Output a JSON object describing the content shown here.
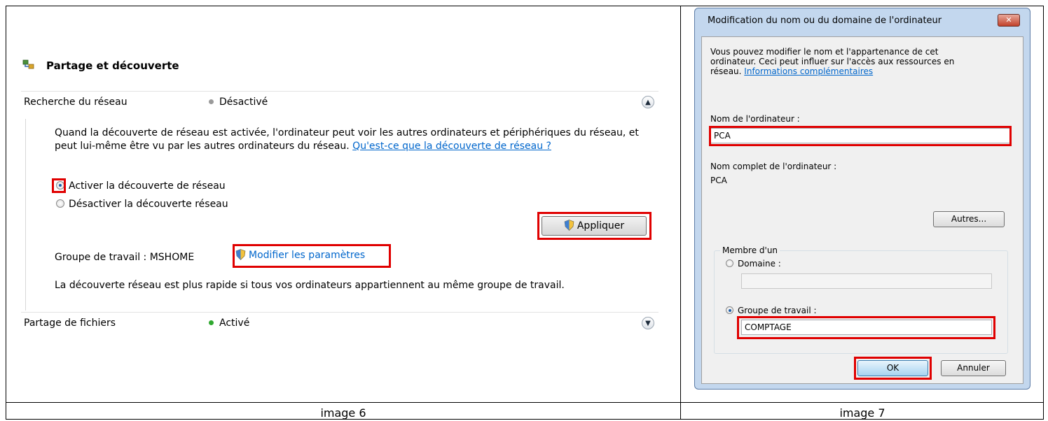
{
  "left_panel": {
    "section_title": "Partage et découverte",
    "network_discovery": {
      "label": "Recherche du réseau",
      "status": "Désactivé",
      "status_color": "#9a9a9a",
      "description": "Quand la découverte de réseau est activée, l'ordinateur peut voir les autres ordinateurs et périphériques du réseau, et peut lui-même être vu par les autres ordinateurs du réseau.",
      "help_link": "Qu'est-ce que la découverte de réseau ?",
      "option_enable": "Activer la découverte de réseau",
      "option_disable": "Désactiver la découverte réseau",
      "selected_option": "option_enable",
      "apply_button": "Appliquer",
      "workgroup_label": "Groupe de travail : MSHOME",
      "change_settings_link": "Modifier les paramètres",
      "footer_note": "La découverte réseau est plus rapide si tous vos ordinateurs appartiennent au même groupe de travail."
    },
    "file_sharing": {
      "label": "Partage de fichiers",
      "status": "Activé",
      "status_color": "#2fa82f"
    }
  },
  "dialog": {
    "title": "Modification du nom ou du domaine de l'ordinateur",
    "close_glyph": "✕",
    "intro_line1": "Vous pouvez modifier le nom et l'appartenance de cet",
    "intro_line2": "ordinateur. Ceci peut influer sur l'accès aux ressources en",
    "intro_line3": "réseau.",
    "more_info_link": "Informations complémentaires",
    "computer_name_label": "Nom de l'ordinateur :",
    "computer_name_value": "PCA",
    "full_name_label": "Nom complet de l'ordinateur :",
    "full_name_value": "PCA",
    "more_button": "Autres...",
    "member_of_legend": "Membre d'un",
    "domain_option": "Domaine :",
    "domain_value": "",
    "workgroup_option": "Groupe de travail :",
    "workgroup_value": "COMPTAGE",
    "selected_membership": "workgroup",
    "ok_button": "OK",
    "cancel_button": "Annuler"
  },
  "captions": {
    "left": "image 6",
    "right": "image 7"
  },
  "colors": {
    "highlight": "#e00000",
    "link": "#0066cc"
  }
}
